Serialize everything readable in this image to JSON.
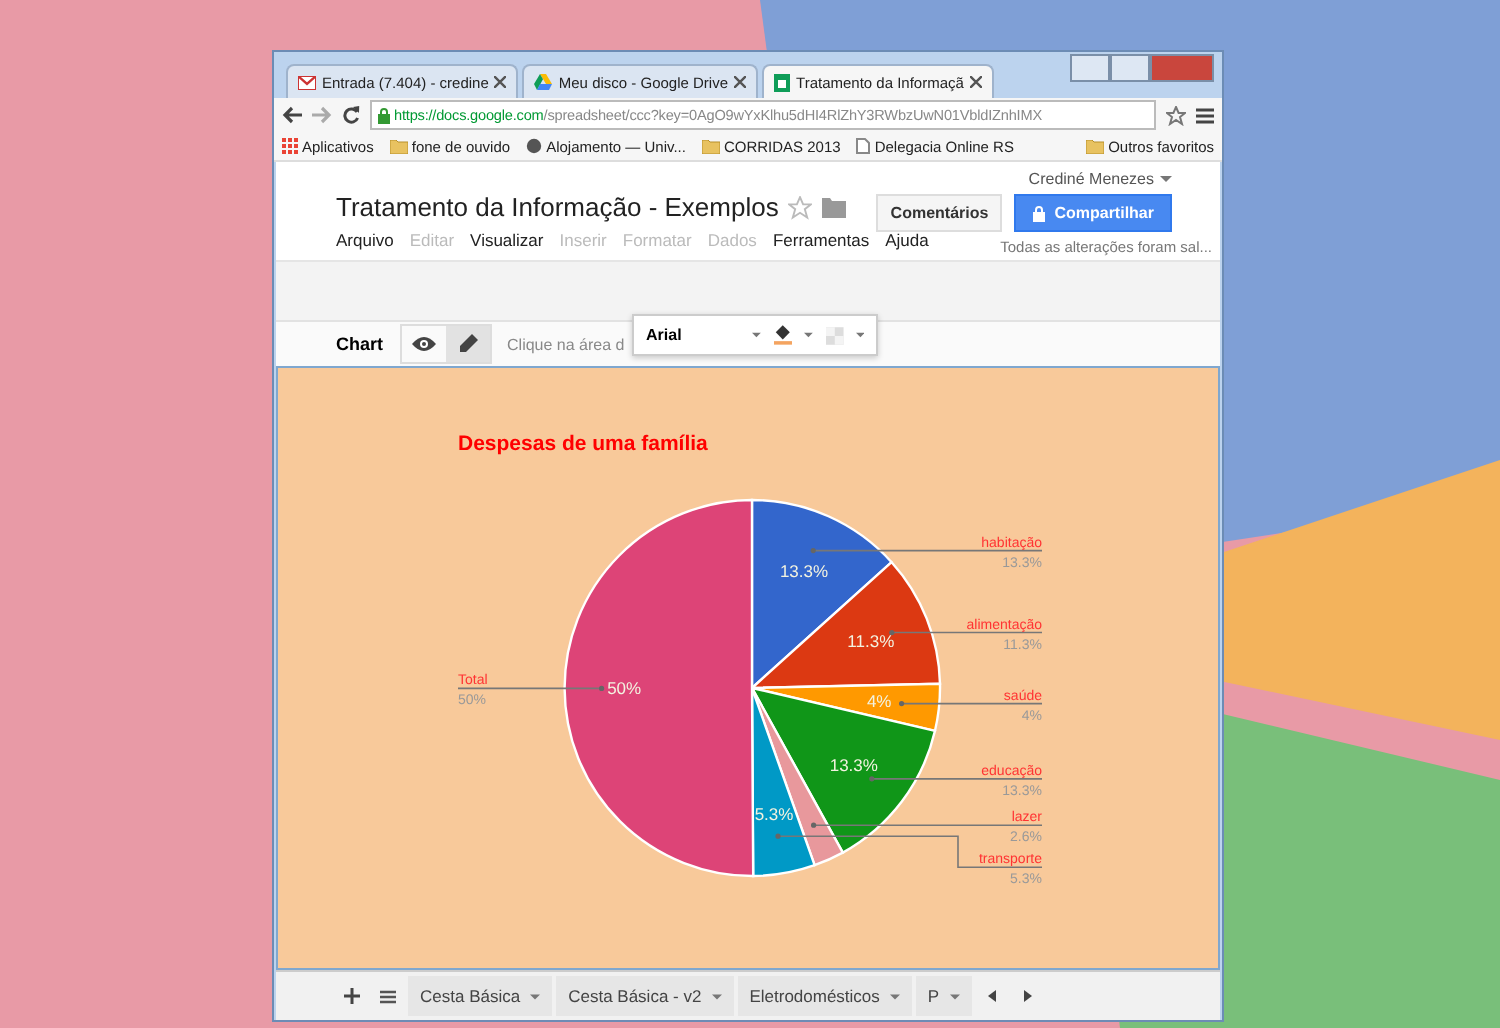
{
  "browser": {
    "tabs": [
      {
        "title": "Entrada (7.404) - credine",
        "kind": "mail",
        "selected": false
      },
      {
        "title": "Meu disco - Google Drive",
        "kind": "drive",
        "selected": false
      },
      {
        "title": "Tratamento da Informaçã",
        "kind": "sheet",
        "selected": true
      }
    ],
    "url_host": "https://docs.google.com",
    "url_path": "/spreadsheet/ccc?key=0AgO9wYxKlhu5dHI4RlZhY3RWbzUwN01VbldIZnhIMX",
    "bookmarks": [
      {
        "label": "Aplicativos",
        "kind": "apps"
      },
      {
        "label": "fone de ouvido",
        "kind": "folder"
      },
      {
        "label": "Alojamento — Univ...",
        "kind": "site"
      },
      {
        "label": "CORRIDAS 2013",
        "kind": "folder"
      },
      {
        "label": "Delegacia Online RS",
        "kind": "page"
      }
    ],
    "other_bookmarks": "Outros favoritos"
  },
  "document": {
    "title": "Tratamento da Informação - Exemplos",
    "user": "Crediné Menezes",
    "comments_button": "Comentários",
    "share_button": "Compartilhar",
    "menu": [
      {
        "label": "Arquivo",
        "disabled": false
      },
      {
        "label": "Editar",
        "disabled": true
      },
      {
        "label": "Visualizar",
        "disabled": false
      },
      {
        "label": "Inserir",
        "disabled": true
      },
      {
        "label": "Formatar",
        "disabled": true
      },
      {
        "label": "Dados",
        "disabled": true
      },
      {
        "label": "Ferramentas",
        "disabled": false
      },
      {
        "label": "Ajuda",
        "disabled": false
      }
    ],
    "save_status": "Todas as alterações foram sal..."
  },
  "chart_toolbar": {
    "label": "Chart",
    "modes": [
      {
        "kind": "view",
        "selected": false
      },
      {
        "kind": "edit",
        "selected": true
      }
    ],
    "hint": "Clique na área d",
    "font": "Arial"
  },
  "chart": {
    "chart_data": {
      "type": "pie",
      "title": "Despesas de uma família",
      "categories": [
        "habitação",
        "alimentação",
        "saúde",
        "educação",
        "lazer",
        "transporte",
        "Total"
      ],
      "values": [
        13.3,
        11.3,
        4,
        13.3,
        2.6,
        5.3,
        50
      ],
      "value_labels": [
        "13.3%",
        "11.3%",
        "4%",
        "13.3%",
        null,
        "5.3%",
        "50%"
      ]
    },
    "slices": [
      {
        "color": "#3366cc",
        "callout_value": "13.3%"
      },
      {
        "color": "#dc3912",
        "callout_value": "11.3%"
      },
      {
        "color": "#ff9900",
        "callout_value": "4%"
      },
      {
        "color": "#109618",
        "callout_value": "13.3%"
      },
      {
        "color": "#e8989c",
        "callout_value": "2.6%"
      },
      {
        "color": "#0099c6",
        "callout_value": "5.3%"
      },
      {
        "color": "#dd4477",
        "callout_value": "50%"
      }
    ]
  },
  "sheet_tabs": [
    {
      "label": "Cesta Básica"
    },
    {
      "label": "Cesta Básica - v2"
    },
    {
      "label": "Eletrodomésticos"
    },
    {
      "label": "P"
    }
  ]
}
